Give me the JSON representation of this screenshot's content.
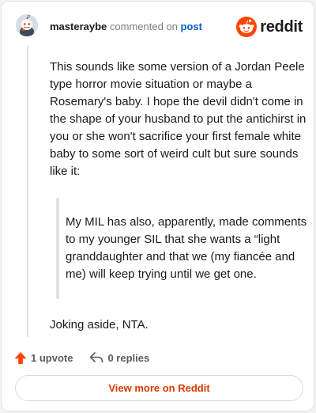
{
  "header": {
    "username": "masteraybe",
    "commented_on": "commented on",
    "post_link": "post",
    "brand": "reddit"
  },
  "comment": {
    "paragraph1": "This sounds like some version of a Jordan Peele type horror movie situation or maybe a Rosemary's baby. I hope the devil didn't come in the shape of your husband to put the antichirst in you or she won't sacrifice your first female white baby to some sort of weird cult but sure sounds like it:",
    "quote": "My MIL has also, apparently, made comments to my younger SIL that she wants a “light granddaughter and that we (my fiancée and me) will keep trying until we get one.",
    "paragraph2": "Joking aside, NTA."
  },
  "actions": {
    "upvotes": "1 upvote",
    "replies": "0 replies"
  },
  "view_more_label": "View more on Reddit",
  "icons": {
    "avatar": "snoo-avatar-icon",
    "brand": "reddit-logo-icon",
    "upvote": "upvote-arrow-icon",
    "reply": "reply-arrow-icon"
  },
  "colors": {
    "brand_orange": "#ff4500",
    "link_blue": "#0a5fc2",
    "view_more_text": "#d93a00"
  }
}
